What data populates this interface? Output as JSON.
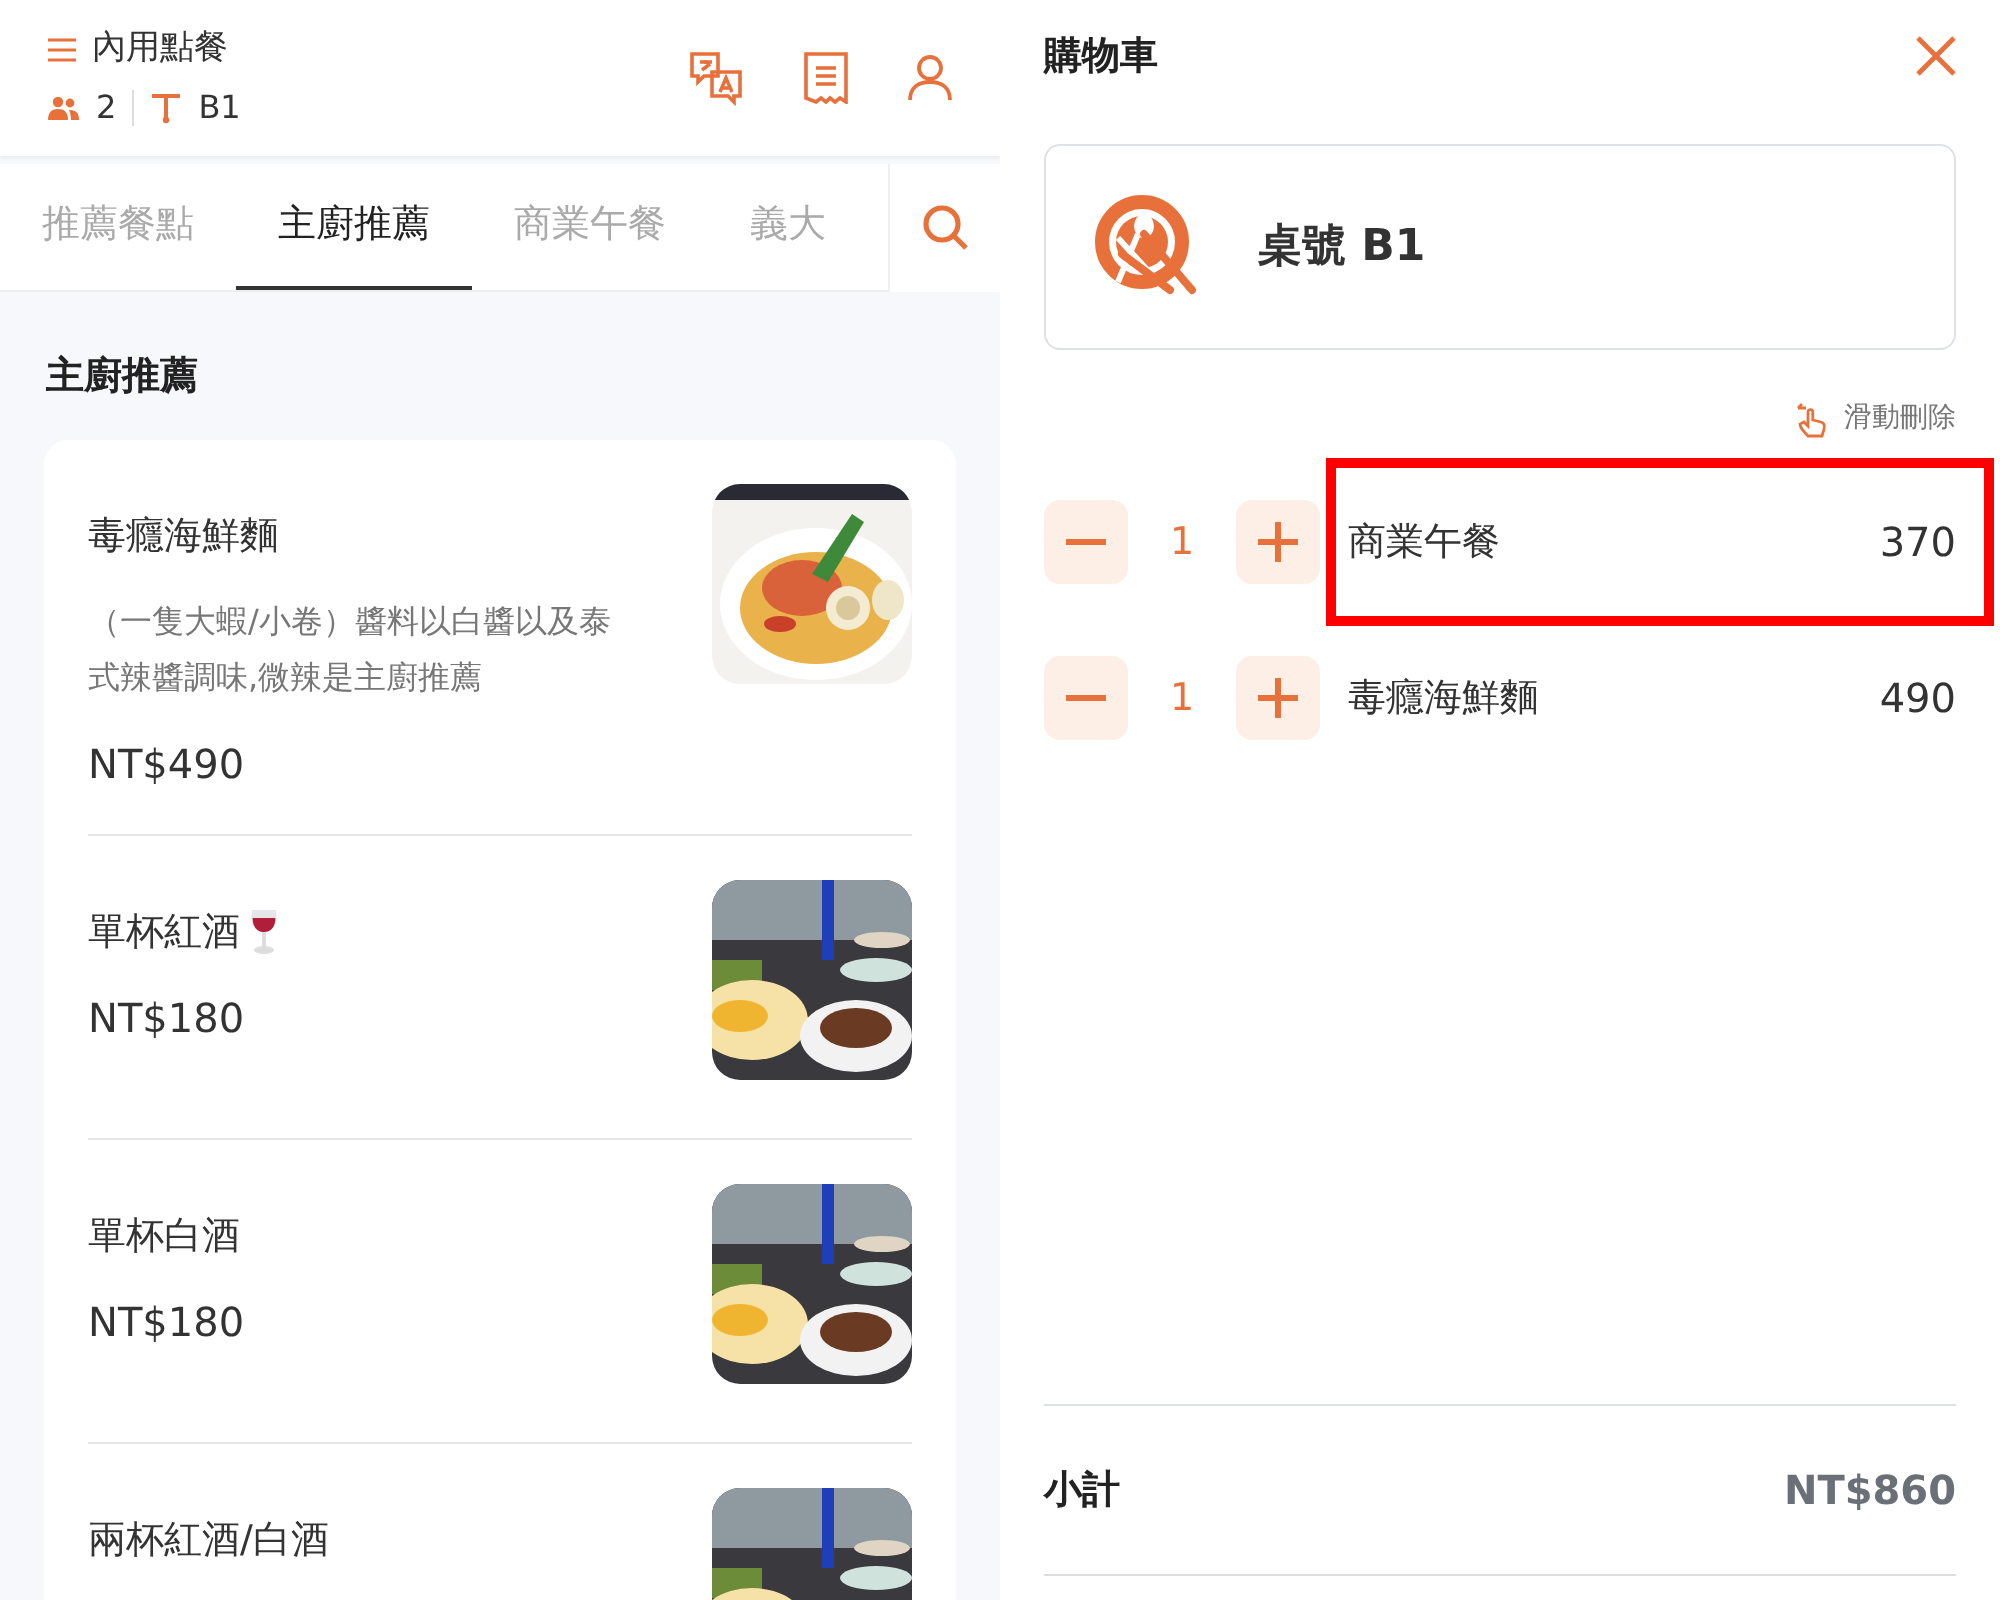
{
  "header": {
    "title": "內用點餐",
    "guests": "2",
    "table": "B1"
  },
  "tabs": [
    {
      "label": "推薦餐點",
      "selected": false
    },
    {
      "label": "主廚推薦",
      "selected": true
    },
    {
      "label": "商業午餐",
      "selected": false
    },
    {
      "label": "義大",
      "selected": false
    }
  ],
  "section_title": "主廚推薦",
  "menu_items": [
    {
      "name": "毒癮海鮮麵",
      "wine_icon": false,
      "description": "（一隻大蝦/小卷）醬料以白醬以及泰式辣醬調味,微辣是主廚推薦",
      "price": "NT$490"
    },
    {
      "name": "單杯紅酒",
      "wine_icon": true,
      "price": "NT$180"
    },
    {
      "name": "單杯白酒",
      "wine_icon": false,
      "price": "NT$180"
    },
    {
      "name": "兩杯紅酒/白酒",
      "wine_icon": false
    }
  ],
  "cart": {
    "title": "購物車",
    "table_label": "桌號 B1",
    "swipe_hint": "滑動刪除",
    "items": [
      {
        "quantity": "1",
        "name": "商業午餐",
        "price": "370",
        "highlighted": true
      },
      {
        "quantity": "1",
        "name": "毒癮海鮮麵",
        "price": "490",
        "highlighted": false
      }
    ],
    "subtotal_label": "小計",
    "subtotal": "NT$860"
  }
}
